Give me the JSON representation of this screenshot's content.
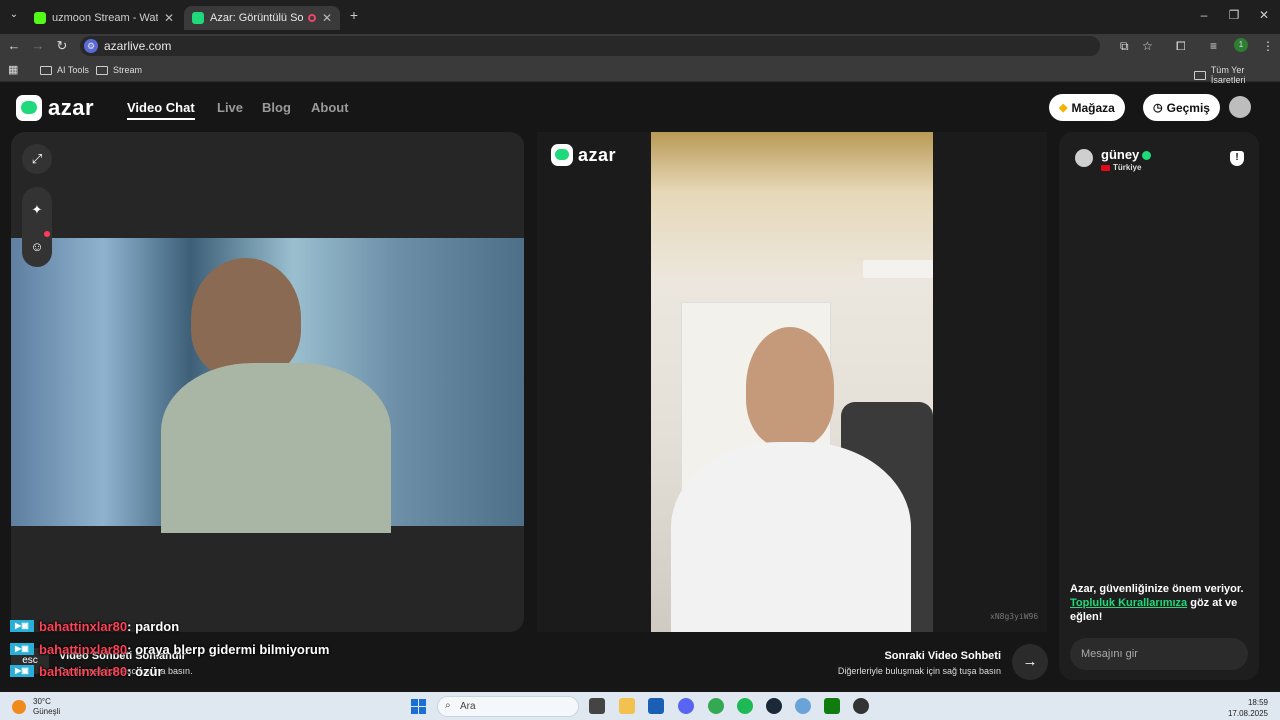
{
  "browser": {
    "tabs": [
      {
        "title": "uzmoon Stream - Watch Live o",
        "favicon_color": "#53fc18",
        "active": false
      },
      {
        "title": "Azar: Görüntülü Sohbet, Arl",
        "favicon_color": "#1fd97a",
        "active": true
      }
    ],
    "new_tab": "+",
    "url": "azarlive.com",
    "bookmarks": [
      "AI Tools",
      "Stream"
    ],
    "all_bookmarks": "Tüm Yer İşaretleri"
  },
  "site": {
    "logo_text": "azar",
    "nav": [
      "Video Chat",
      "Live",
      "Blog",
      "About"
    ],
    "store_label": "Mağaza",
    "history_label": "Geçmiş"
  },
  "partner": {
    "name": "güney",
    "country": "Türkiye",
    "watermark": "xN8g3yiW96"
  },
  "center_logo_text": "azar",
  "chat_panel": {
    "safety_line1": "Azar, güvenliğinize önem veriyor.",
    "safety_link": "Topluluk Kurallarımıza",
    "safety_line2": "göz at ve eğlen!",
    "input_placeholder": "Mesajını gir"
  },
  "controls": {
    "esc_label": "esc",
    "end_title": "Video Sohbeti Sonlandır",
    "end_sub": "Durdurmak için esc tuşuna basın.",
    "next_title": "Sonraki Video Sohbeti",
    "next_sub": "Diğerleriyle buluşmak için sağ tuşa basın",
    "next_icon": "→"
  },
  "stream_chat": [
    {
      "user": "bahattinxlar80",
      "message": ": pardon"
    },
    {
      "user": "bahattinxlar80",
      "message": ": oraya blerp gidermi bilmiyorum"
    },
    {
      "user": "bahattinxlar80",
      "message": ": özür"
    }
  ],
  "taskbar": {
    "temp": "30°C",
    "weather": "Güneşli",
    "search_placeholder": "Ara",
    "time": "18:59",
    "date": "17.08.2025"
  },
  "colors": {
    "accent_green": "#1fd97a",
    "chat_user": "#ff4257",
    "panel": "#262626"
  }
}
